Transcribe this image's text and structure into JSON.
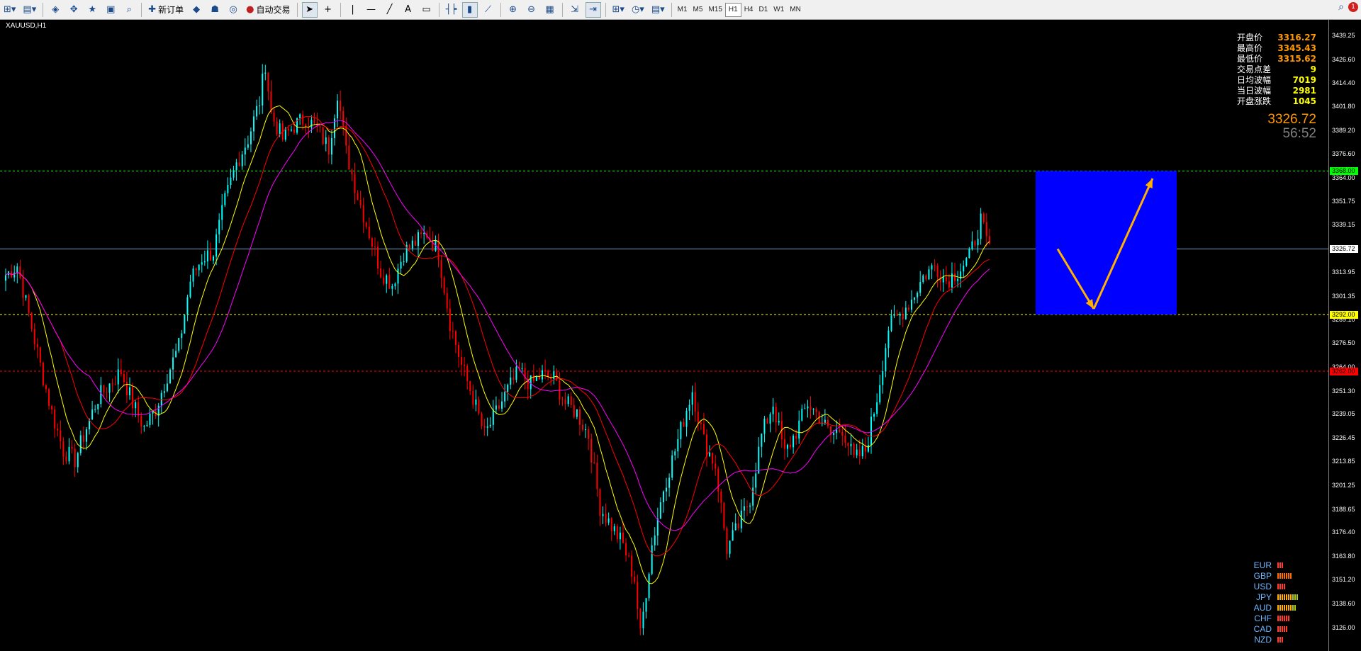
{
  "toolbar": {
    "new_order_label": "新订单",
    "auto_trade_label": "自动交易",
    "timeframes": [
      "M1",
      "M5",
      "M15",
      "H1",
      "H4",
      "D1",
      "W1",
      "MN"
    ],
    "active_timeframe": "H1"
  },
  "notification_count": "1",
  "chart": {
    "symbol_label": "XAUUSD,H1",
    "info": [
      {
        "key": "开盘价",
        "value": "3316.27",
        "color": "#ff9900"
      },
      {
        "key": "最高价",
        "value": "3345.43",
        "color": "#ff9900"
      },
      {
        "key": "最低价",
        "value": "3315.62",
        "color": "#ff9900"
      },
      {
        "key": "交易点差",
        "value": "9",
        "color": "#ffff00"
      },
      {
        "key": "日均波幅",
        "value": "7019",
        "color": "#ffff00"
      },
      {
        "key": "当日波幅",
        "value": "2981",
        "color": "#ffff00"
      },
      {
        "key": "开盘涨跌",
        "value": "1045",
        "color": "#ffff00"
      }
    ],
    "current_price": "3326.72",
    "timer": "56:52",
    "currencies": [
      {
        "name": "EUR",
        "strength": 3,
        "color": "#ff3b30"
      },
      {
        "name": "GBP",
        "strength": 7,
        "color": "#ff6a00"
      },
      {
        "name": "USD",
        "strength": 4,
        "color": "#ff3b30"
      },
      {
        "name": "JPY",
        "strength": 10,
        "color": "#ffb000"
      },
      {
        "name": "AUD",
        "strength": 9,
        "color": "#ffb000"
      },
      {
        "name": "CHF",
        "strength": 6,
        "color": "#ff3b30"
      },
      {
        "name": "CAD",
        "strength": 5,
        "color": "#ff3b30"
      },
      {
        "name": "NZD",
        "strength": 3,
        "color": "#ff3b30"
      }
    ],
    "colors": {
      "bull": "#00ffff",
      "bear": "#ff0000",
      "ma_fast": "#ffff00",
      "ma_mid": "#ff0000",
      "ma_slow": "#ff00ff",
      "forecast_box": "#0000ff",
      "arrow": "#ffb000"
    }
  },
  "chart_data": {
    "type": "candlestick",
    "symbol": "XAUUSD",
    "timeframe": "H1",
    "ylim": [
      3118.0,
      3445.0
    ],
    "y_ticks": [
      "3439.25",
      "3426.60",
      "3414.40",
      "3401.80",
      "3389.20",
      "3376.60",
      "3364.00",
      "3351.75",
      "3339.15",
      "3326.72",
      "3313.95",
      "3301.35",
      "3289.10",
      "3276.50",
      "3264.00",
      "3251.30",
      "3239.05",
      "3226.45",
      "3213.85",
      "3201.25",
      "3188.65",
      "3176.40",
      "3163.80",
      "3151.20",
      "3138.60",
      "3126.00"
    ],
    "horizontal_lines": [
      {
        "price": 3368.0,
        "label": "3368.00",
        "color": "#00ff00",
        "style": "dashed"
      },
      {
        "price": 3326.72,
        "label": "3326.72",
        "color": "#7f9fbf",
        "style": "solid"
      },
      {
        "price": 3292.0,
        "label": "3292.00",
        "color": "#ffff00",
        "style": "dashed"
      },
      {
        "price": 3262.0,
        "label": "3262.00",
        "color": "#ff0000",
        "style": "dashed"
      }
    ],
    "forecast_box": {
      "top_price": 3368.0,
      "bottom_price": 3292.0
    },
    "forecast_path": [
      3326.72,
      3295.0,
      3364.0
    ],
    "key_points": [
      [
        0,
        3313
      ],
      [
        4,
        3318
      ],
      [
        8,
        3292
      ],
      [
        12,
        3265
      ],
      [
        16,
        3240
      ],
      [
        20,
        3220
      ],
      [
        24,
        3215
      ],
      [
        28,
        3232
      ],
      [
        32,
        3248
      ],
      [
        36,
        3255
      ],
      [
        40,
        3262
      ],
      [
        44,
        3245
      ],
      [
        48,
        3232
      ],
      [
        52,
        3242
      ],
      [
        56,
        3260
      ],
      [
        60,
        3275
      ],
      [
        64,
        3310
      ],
      [
        68,
        3322
      ],
      [
        72,
        3325
      ],
      [
        76,
        3352
      ],
      [
        80,
        3372
      ],
      [
        84,
        3385
      ],
      [
        88,
        3405
      ],
      [
        90,
        3425
      ],
      [
        92,
        3398
      ],
      [
        96,
        3385
      ],
      [
        100,
        3392
      ],
      [
        104,
        3396
      ],
      [
        108,
        3390
      ],
      [
        112,
        3380
      ],
      [
        115,
        3410
      ],
      [
        118,
        3378
      ],
      [
        122,
        3355
      ],
      [
        126,
        3335
      ],
      [
        130,
        3315
      ],
      [
        134,
        3308
      ],
      [
        138,
        3325
      ],
      [
        142,
        3330
      ],
      [
        146,
        3335
      ],
      [
        150,
        3325
      ],
      [
        154,
        3288
      ],
      [
        158,
        3265
      ],
      [
        162,
        3248
      ],
      [
        166,
        3228
      ],
      [
        170,
        3240
      ],
      [
        174,
        3252
      ],
      [
        178,
        3262
      ],
      [
        182,
        3255
      ],
      [
        186,
        3260
      ],
      [
        190,
        3258
      ],
      [
        194,
        3245
      ],
      [
        198,
        3240
      ],
      [
        202,
        3228
      ],
      [
        206,
        3190
      ],
      [
        210,
        3180
      ],
      [
        214,
        3170
      ],
      [
        218,
        3152
      ],
      [
        220,
        3122
      ],
      [
        224,
        3170
      ],
      [
        228,
        3200
      ],
      [
        232,
        3220
      ],
      [
        236,
        3242
      ],
      [
        238,
        3252
      ],
      [
        242,
        3225
      ],
      [
        246,
        3212
      ],
      [
        250,
        3168
      ],
      [
        254,
        3180
      ],
      [
        258,
        3195
      ],
      [
        262,
        3228
      ],
      [
        266,
        3245
      ],
      [
        270,
        3218
      ],
      [
        274,
        3230
      ],
      [
        278,
        3245
      ],
      [
        282,
        3238
      ],
      [
        286,
        3228
      ],
      [
        290,
        3232
      ],
      [
        294,
        3215
      ],
      [
        298,
        3220
      ],
      [
        302,
        3248
      ],
      [
        306,
        3285
      ],
      [
        310,
        3292
      ],
      [
        314,
        3300
      ],
      [
        318,
        3312
      ],
      [
        322,
        3318
      ],
      [
        326,
        3310
      ],
      [
        330,
        3315
      ],
      [
        334,
        3322
      ],
      [
        338,
        3342
      ],
      [
        340,
        3330
      ],
      [
        341,
        3326.72
      ]
    ]
  }
}
